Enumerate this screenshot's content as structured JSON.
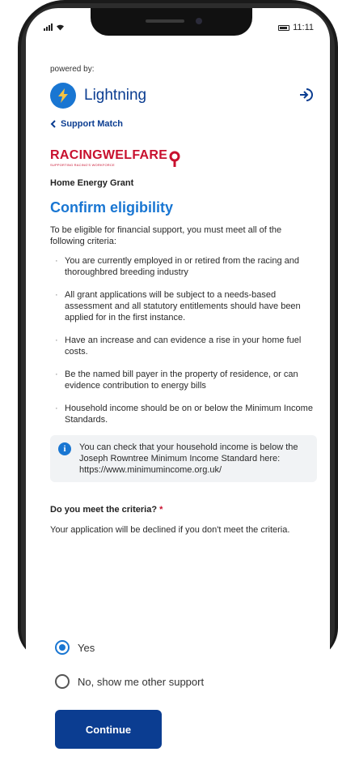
{
  "status_bar": {
    "time": "11:11"
  },
  "powered_by": "powered by:",
  "brand": {
    "name": "Lightning",
    "accent": "#1976d2"
  },
  "nav": {
    "back_label": "Support Match"
  },
  "partner": {
    "name": "RACINGWELFARE",
    "tagline": "SUPPORTING RACING'S WORKFORCE"
  },
  "grant_name": "Home Energy Grant",
  "heading": "Confirm eligibility",
  "intro": "To be eligible for financial support, you must meet all of the following criteria:",
  "criteria": [
    "You are currently employed in or retired from the racing and thoroughbred breeding industry",
    "All grant applications will be subject to a needs-based assessment and all statutory entitlements should have been applied for in the first instance.",
    "Have an increase and can evidence a rise in your home fuel costs.",
    "Be the named bill payer in the property of residence, or can evidence contribution to energy bills",
    "Household income should be on or below the Minimum Income Standards."
  ],
  "info": "You can check that your household income is below the Joseph Rowntree Minimum Income Standard here: https://www.minimumincome.org.uk/",
  "question": {
    "label": "Do you meet the criteria?",
    "required_mark": "*",
    "help": "Your application will be declined if you don't meet the criteria.",
    "options": [
      {
        "label": "Yes",
        "selected": true
      },
      {
        "label": "No, show me other support",
        "selected": false
      }
    ]
  },
  "continue_label": "Continue"
}
